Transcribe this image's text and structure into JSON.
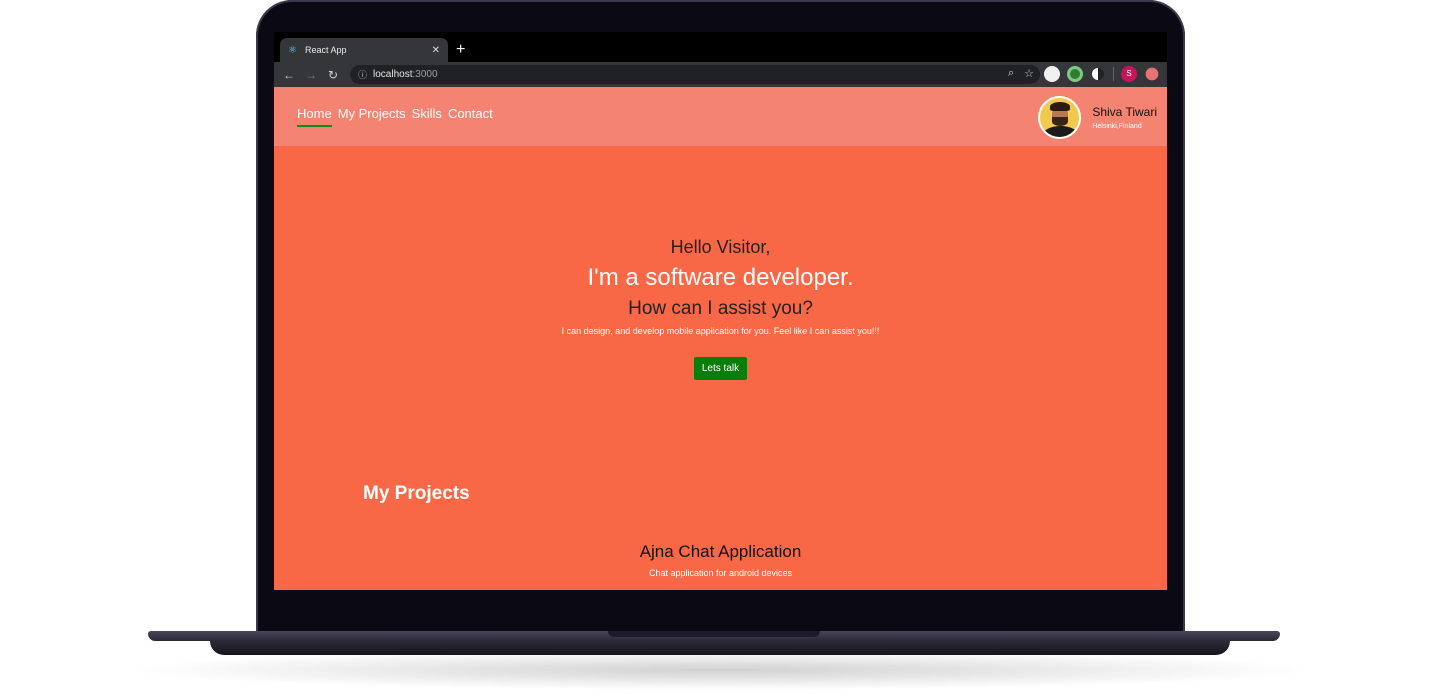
{
  "browser": {
    "tab_title": "React App",
    "tab_close": "✕",
    "new_tab": "+",
    "url_host": "localhost",
    "url_port": ":3000",
    "profile_initial": "S"
  },
  "nav": {
    "items": [
      "Home",
      "My Projects",
      "Skills",
      "Contact"
    ]
  },
  "profile": {
    "name": "Shiva Tiwari",
    "location": "Helsinki,Finland"
  },
  "hero": {
    "greeting": "Hello Visitor,",
    "headline": "I'm a software developer.",
    "question": "How can I assist you?",
    "blurb": "I can design, and develop mobile application for you. Feel like I can assist you!!!",
    "cta_label": "Lets talk"
  },
  "projects": {
    "section_title": "My Projects",
    "items": [
      {
        "title": "Ajna Chat Application",
        "description": "Chat application for android devices"
      }
    ]
  },
  "colors": {
    "page_bg": "#f96846",
    "header_bg": "#f58371",
    "cta_bg": "#0a7e0a",
    "active_underline": "#138a1c"
  }
}
